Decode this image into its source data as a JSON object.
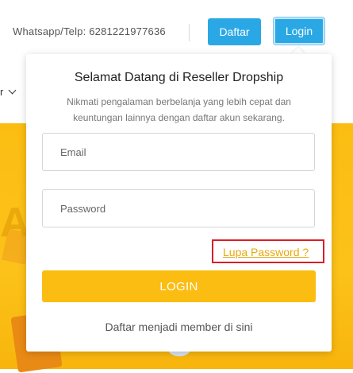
{
  "header": {
    "contact_text": "Whatsapp/Telp: 6281221977636",
    "register_label": "Daftar",
    "login_label": "Login",
    "nav_fragment": "r"
  },
  "banner": {
    "letter": "A"
  },
  "login_panel": {
    "title": "Selamat Datang di Reseller Dropship",
    "subtitle": "Nikmati pengalaman berbelanja yang lebih cepat dan keuntungan lainnya dengan daftar akun sekarang.",
    "email_placeholder": "Email",
    "password_placeholder": "Password",
    "forgot_password": "Lupa Password ?",
    "login_button": "LOGIN",
    "register_link": "Daftar menjadi member di sini"
  },
  "colors": {
    "primary_blue": "#2aa8e6",
    "brand_yellow": "#fbbd12",
    "highlight_red": "#d81f26"
  }
}
